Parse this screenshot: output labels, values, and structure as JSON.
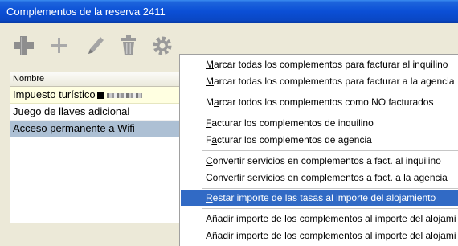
{
  "window": {
    "title": "Complementos de la reserva 2411"
  },
  "toolbar": {
    "buttons": [
      {
        "icon": "add-filled-icon"
      },
      {
        "icon": "add-icon"
      },
      {
        "icon": "pencil-icon"
      },
      {
        "icon": "trash-icon"
      },
      {
        "icon": "gear-icon"
      }
    ]
  },
  "list": {
    "header": "Nombre",
    "rows": [
      {
        "label": "Impuesto turístico"
      },
      {
        "label": "Juego de llaves adicional"
      },
      {
        "label": "Acceso permanente a Wifi"
      }
    ]
  },
  "menu": {
    "items": [
      {
        "pre": "",
        "acc": "M",
        "post": "arcar todas los complementos para facturar al inquilino"
      },
      {
        "pre": "",
        "acc": "M",
        "post": "arcar todas los complementos para facturar a la agencia"
      },
      {
        "pre": "M",
        "acc": "a",
        "post": "rcar todos los complementos como NO facturados"
      },
      {
        "pre": "",
        "acc": "F",
        "post": "acturar los complementos de inquilino"
      },
      {
        "pre": "F",
        "acc": "a",
        "post": "cturar los complementos de agencia"
      },
      {
        "pre": "",
        "acc": "C",
        "post": "onvertir servicios en complementos a fact. al inquilino"
      },
      {
        "pre": "C",
        "acc": "o",
        "post": "nvertir servicios en complementos a fact. a la agencia"
      },
      {
        "pre": "",
        "acc": "R",
        "post": "estar importe de las tasas al importe del alojamiento"
      },
      {
        "pre": "",
        "acc": "A",
        "post": "ñadir importe de los complementos al importe del alojami"
      },
      {
        "pre": "Añad",
        "acc": "i",
        "post": "r importe de los complementos al importe del alojami"
      }
    ]
  }
}
